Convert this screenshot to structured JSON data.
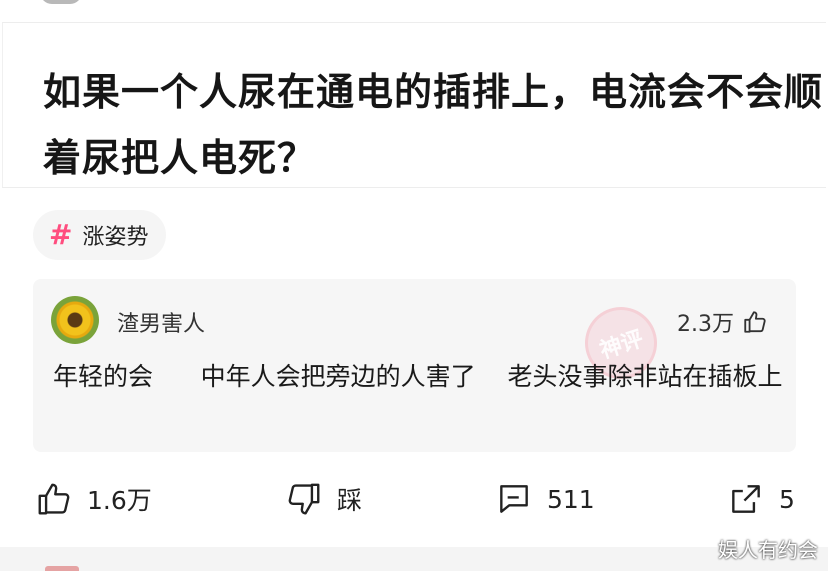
{
  "post": {
    "title": "如果一个人尿在通电的插排上，电流会不会顺着尿把人电死？",
    "topic_tag": "涨姿势"
  },
  "top_comment": {
    "username": "渣男害人",
    "likes": "2.3万",
    "text": "年轻的会      中年人会把旁边的人害了    老头没事除非站在插板上",
    "badge_icon": "shenping-stamp-icon",
    "badge_text": "神评"
  },
  "actions": {
    "like_count": "1.6万",
    "dislike_label": "踩",
    "comment_count": "511",
    "share_count": "5"
  },
  "watermark": "娱人有约会",
  "colors": {
    "tag_hash": "#ff4d7f",
    "card_bg": "#f6f6f6",
    "text": "#1a1a1a"
  }
}
